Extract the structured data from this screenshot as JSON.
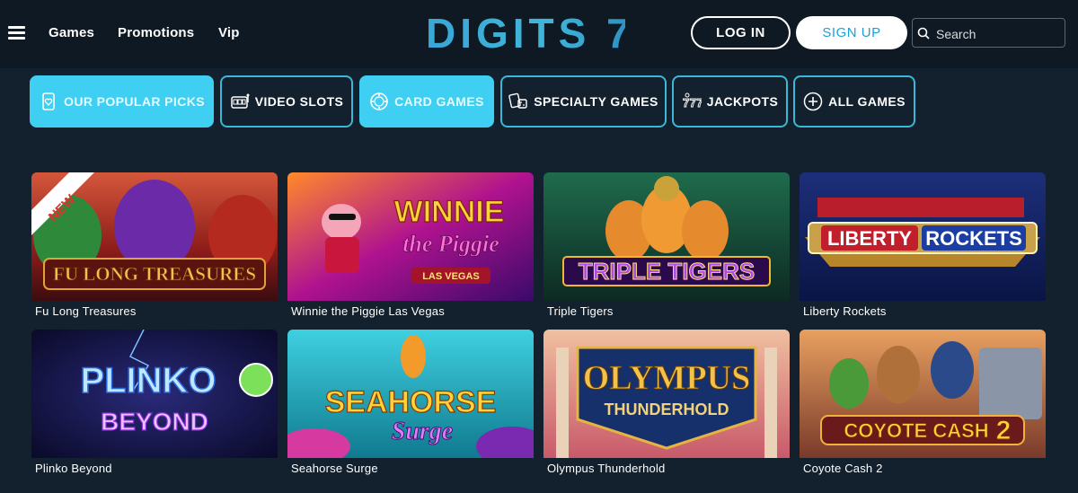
{
  "header": {
    "nav": [
      "Games",
      "Promotions",
      "Vip"
    ],
    "logo_text": "DIGITS 7",
    "login_label": "LOG IN",
    "signup_label": "SIGN UP",
    "search_placeholder": "Search"
  },
  "tabs": [
    {
      "label": "OUR POPULAR PICKS",
      "icon": "popular-picks-icon",
      "active": true
    },
    {
      "label": "VIDEO SLOTS",
      "icon": "slot-machine-icon",
      "active": false
    },
    {
      "label": "CARD GAMES",
      "icon": "poker-chip-icon",
      "active": true
    },
    {
      "label": "SPECIALTY GAMES",
      "icon": "cards-dice-icon",
      "active": false
    },
    {
      "label": "JACKPOTS",
      "icon": "jackpot-icon",
      "active": false
    },
    {
      "label": "ALL GAMES",
      "icon": "plus-circle-icon",
      "active": false
    }
  ],
  "games": [
    {
      "title": "Fu Long Treasures",
      "art_text": "FU LONG TREASURES",
      "badge": "NEW"
    },
    {
      "title": "Winnie the Piggie Las Vegas",
      "art_text": "WINNIE",
      "art_text2": "the Piggie",
      "art_text3": "LAS VEGAS"
    },
    {
      "title": "Triple Tigers",
      "art_text": "TRIPLE TIGERS"
    },
    {
      "title": "Liberty Rockets",
      "art_text": "LIBERTY",
      "art_text2": "ROCKETS"
    },
    {
      "title": "Plinko Beyond",
      "art_text": "PLINKO",
      "art_text2": "BEYOND"
    },
    {
      "title": "Seahorse Surge",
      "art_text": "SEAHORSE",
      "art_text2": "Surge"
    },
    {
      "title": "Olympus Thunderhold",
      "art_text": "OLYMPUS",
      "art_text2": "THUNDERHOLD"
    },
    {
      "title": "Coyote Cash 2",
      "art_text": "COYOTE CASH",
      "art_text2": "2"
    }
  ],
  "colors": {
    "background": "#13202d",
    "header": "#0e1923",
    "accent": "#3fcff2",
    "tab_border": "#3bb8d8",
    "signup_text": "#1e9fd8"
  }
}
